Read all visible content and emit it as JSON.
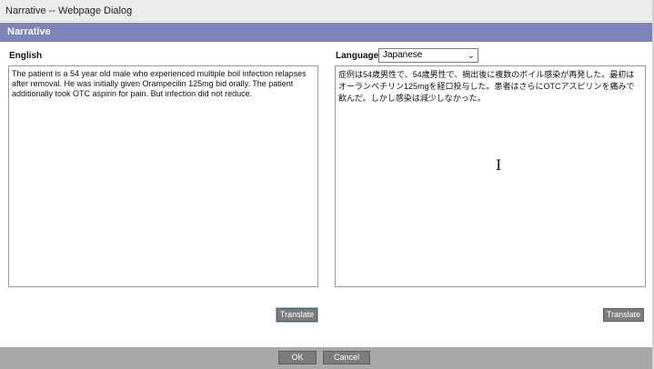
{
  "window": {
    "title": "Narrative -- Webpage Dialog"
  },
  "header": {
    "title": "Narrative"
  },
  "english": {
    "label": "English",
    "text": "The patient is a 54 year old male who experienced multiple boil infection relapses after removal. He was initially given Orampecilin 125mg bid orally. The patient additionally took OTC aspirin for pain. But infection did not reduce.",
    "translate_label": "Translate"
  },
  "language": {
    "label": "Language",
    "selected": "Japanese",
    "text": "症例は54歳男性で、54歳男性で、摘出後に複数のボイル感染が再発した。最初はオーランペチリン125mgを経口投与した。患者はさらにOTCアスピリンを痛みで飲んだ。しかし感染は減少しなかった。",
    "translate_label": "Translate"
  },
  "footer": {
    "ok_label": "OK",
    "cancel_label": "Cancel"
  }
}
